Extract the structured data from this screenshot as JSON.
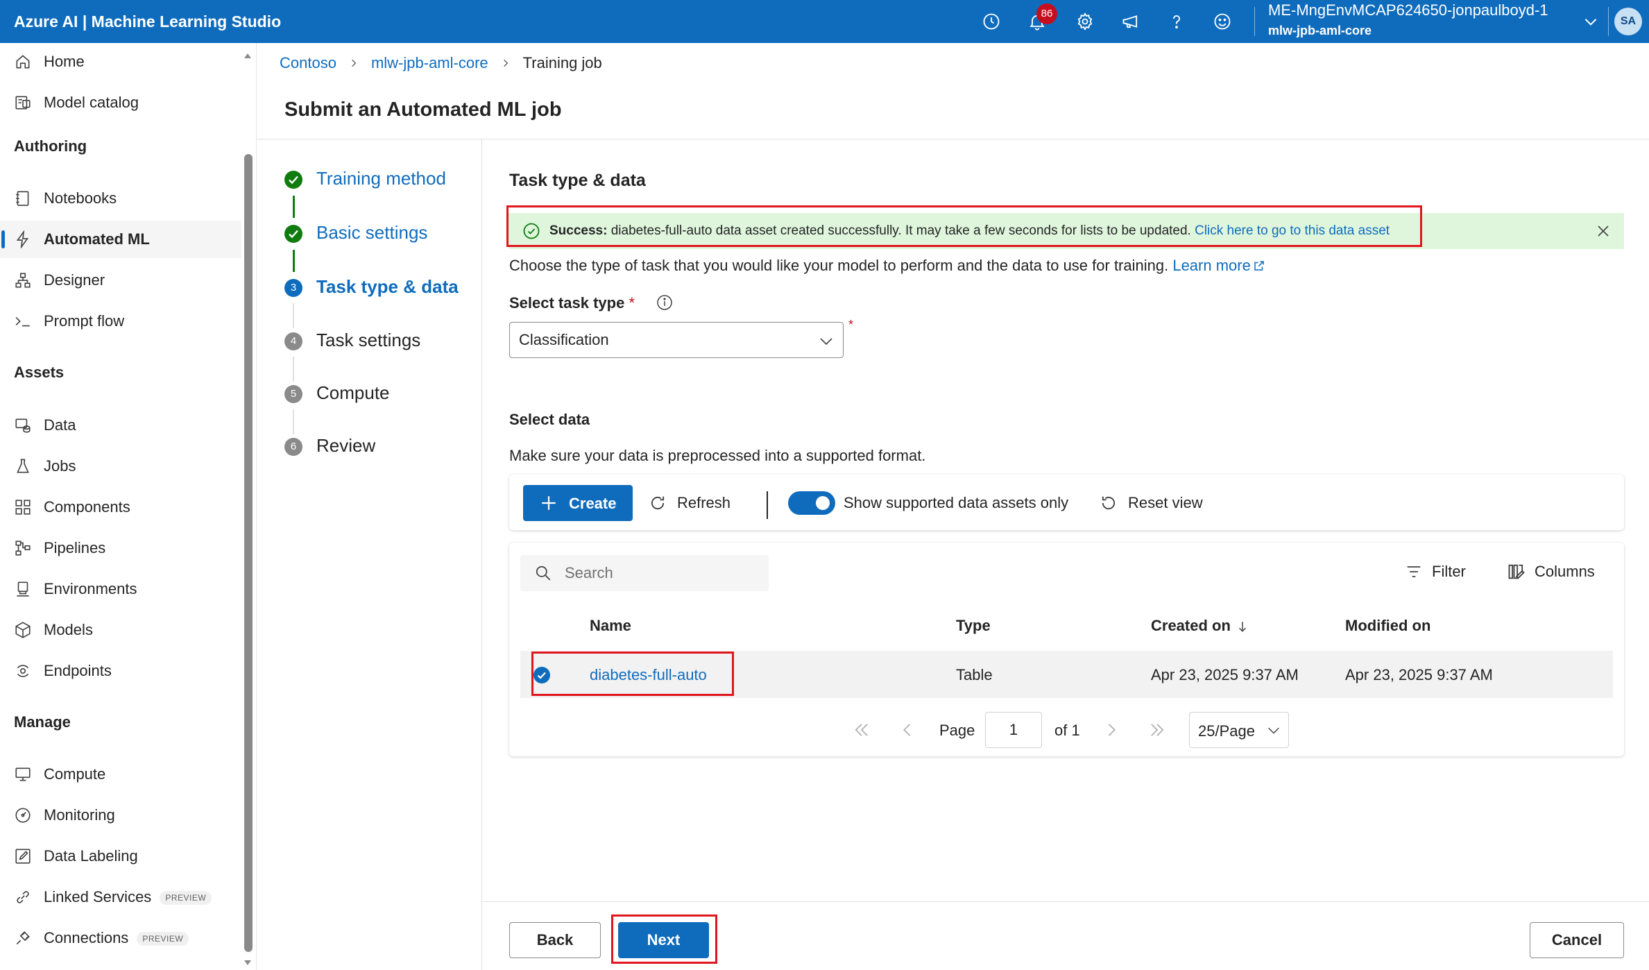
{
  "topbar": {
    "brand": "Azure AI | Machine Learning Studio",
    "notification_count": "86",
    "workspace_name": "ME-MngEnvMCAP624650-jonpaulboyd-1",
    "workspace_sub": "mlw-jpb-aml-core",
    "avatar_initials": "SA",
    "icons": [
      "history-icon",
      "bell-icon",
      "gear-icon",
      "megaphone-icon",
      "help-icon",
      "smiley-icon",
      "chevron-down-icon"
    ]
  },
  "sidebar": {
    "items_top": [
      {
        "label": "Home",
        "icon": "home-icon"
      },
      {
        "label": "Model catalog",
        "icon": "model-catalog-icon"
      }
    ],
    "sections": [
      {
        "title": "Authoring",
        "items": [
          {
            "label": "Notebooks",
            "icon": "notebook-icon"
          },
          {
            "label": "Automated ML",
            "icon": "automl-icon",
            "active": true
          },
          {
            "label": "Designer",
            "icon": "designer-icon"
          },
          {
            "label": "Prompt flow",
            "icon": "prompt-flow-icon"
          }
        ]
      },
      {
        "title": "Assets",
        "items": [
          {
            "label": "Data",
            "icon": "data-icon"
          },
          {
            "label": "Jobs",
            "icon": "flask-icon"
          },
          {
            "label": "Components",
            "icon": "components-icon"
          },
          {
            "label": "Pipelines",
            "icon": "pipelines-icon"
          },
          {
            "label": "Environments",
            "icon": "environments-icon"
          },
          {
            "label": "Models",
            "icon": "cube-icon"
          },
          {
            "label": "Endpoints",
            "icon": "endpoints-icon"
          }
        ]
      },
      {
        "title": "Manage",
        "items": [
          {
            "label": "Compute",
            "icon": "monitor-icon"
          },
          {
            "label": "Monitoring",
            "icon": "gauge-icon"
          },
          {
            "label": "Data Labeling",
            "icon": "edit-icon"
          },
          {
            "label": "Linked Services",
            "icon": "link-icon",
            "badge": "PREVIEW"
          },
          {
            "label": "Connections",
            "icon": "plug-icon",
            "badge": "PREVIEW"
          }
        ]
      }
    ]
  },
  "breadcrumb": {
    "items": [
      "Contoso",
      "mlw-jpb-aml-core"
    ],
    "current": "Training job"
  },
  "page_title": "Submit an Automated ML job",
  "steps": [
    {
      "label": "Training method",
      "status": "done"
    },
    {
      "label": "Basic settings",
      "status": "done"
    },
    {
      "label": "Task type & data",
      "status": "current",
      "number": "3"
    },
    {
      "label": "Task settings",
      "status": "todo",
      "number": "4"
    },
    {
      "label": "Compute",
      "status": "todo",
      "number": "5"
    },
    {
      "label": "Review",
      "status": "todo",
      "number": "6"
    }
  ],
  "main": {
    "section_title": "Task type & data",
    "success": {
      "bold": "Success:",
      "message": " diabetes-full-auto data asset created successfully. It may take a few seconds for lists to be updated. ",
      "link": "Click here to go to this data asset"
    },
    "intro": "Choose the type of task that you would like your model to perform and the data to use for training. ",
    "learn_more": "Learn more",
    "task_type_label": "Select task type",
    "required_mark": "*",
    "task_type_value": "Classification",
    "select_data_title": "Select data",
    "select_data_desc": "Make sure your data is preprocessed into a supported format.",
    "toolbar": {
      "create": "Create",
      "refresh": "Refresh",
      "toggle_label": "Show supported data assets only",
      "toggle_on": true,
      "reset_view": "Reset view"
    },
    "table": {
      "search_placeholder": "Search",
      "filter": "Filter",
      "columns": "Columns",
      "headers": [
        "Name",
        "Type",
        "Created on",
        "Modified on"
      ],
      "rows": [
        {
          "selected": true,
          "name": "diabetes-full-auto",
          "type": "Table",
          "created": "Apr 23, 2025 9:37 AM",
          "modified": "Apr 23, 2025 9:37 AM"
        }
      ],
      "pager": {
        "page_label": "Page",
        "page_value": "1",
        "of_label": "of 1",
        "page_size": "25/Page"
      }
    }
  },
  "footer": {
    "back": "Back",
    "next": "Next",
    "cancel": "Cancel"
  },
  "colors": {
    "brand_blue": "#0f6cbd",
    "success_green": "#107c10",
    "success_bg": "#dff6dd",
    "highlight_red": "#e0161e"
  }
}
